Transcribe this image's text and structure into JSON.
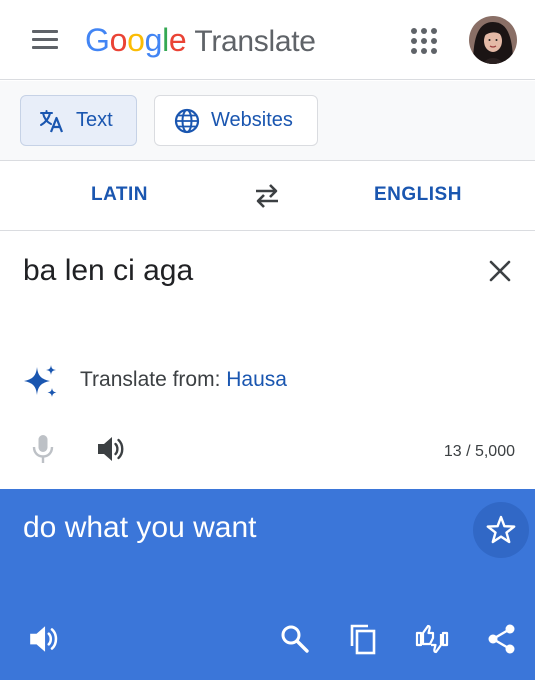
{
  "header": {
    "logo_brand": [
      "G",
      "o",
      "o",
      "g",
      "l",
      "e"
    ],
    "logo_product": "Translate",
    "icons": {
      "menu": "hamburger-menu-icon",
      "apps": "apps-grid-icon",
      "avatar": "user-avatar"
    }
  },
  "modes": {
    "text_label": "Text",
    "websites_label": "Websites",
    "selected": "Text"
  },
  "languages": {
    "source": "LATIN",
    "target": "ENGLISH",
    "swap_icon": "swap-arrows-icon"
  },
  "input": {
    "text": "ba len ci aga",
    "detect_prefix": "Translate from: ",
    "detect_language": "Hausa",
    "char_count": "13 / 5,000"
  },
  "output": {
    "text": "do what you want"
  },
  "colors": {
    "accent": "#1a56b0",
    "result_bg": "#3b76d9",
    "header_border": "#dadce0"
  }
}
